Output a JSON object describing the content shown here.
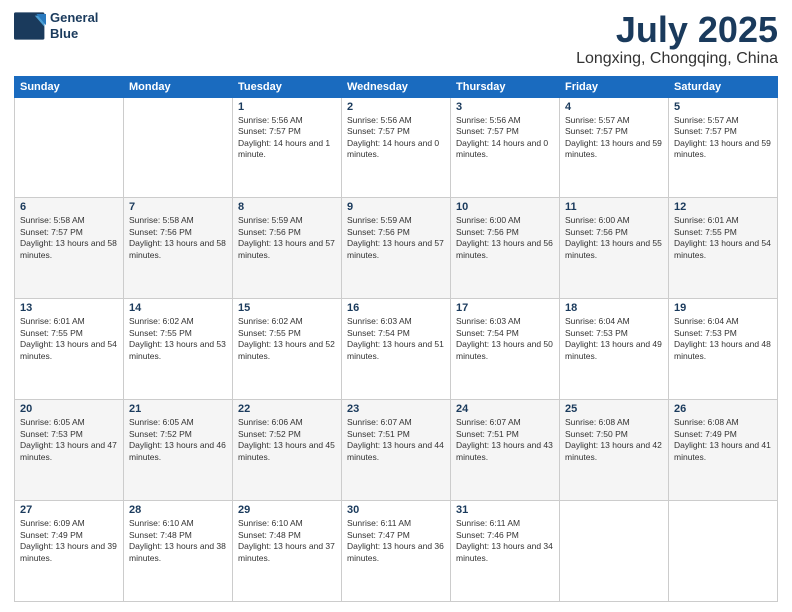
{
  "header": {
    "logo_line1": "General",
    "logo_line2": "Blue",
    "month": "July 2025",
    "location": "Longxing, Chongqing, China"
  },
  "weekdays": [
    "Sunday",
    "Monday",
    "Tuesday",
    "Wednesday",
    "Thursday",
    "Friday",
    "Saturday"
  ],
  "weeks": [
    [
      {
        "day": "",
        "sunrise": "",
        "sunset": "",
        "daylight": ""
      },
      {
        "day": "",
        "sunrise": "",
        "sunset": "",
        "daylight": ""
      },
      {
        "day": "1",
        "sunrise": "Sunrise: 5:56 AM",
        "sunset": "Sunset: 7:57 PM",
        "daylight": "Daylight: 14 hours and 1 minute."
      },
      {
        "day": "2",
        "sunrise": "Sunrise: 5:56 AM",
        "sunset": "Sunset: 7:57 PM",
        "daylight": "Daylight: 14 hours and 0 minutes."
      },
      {
        "day": "3",
        "sunrise": "Sunrise: 5:56 AM",
        "sunset": "Sunset: 7:57 PM",
        "daylight": "Daylight: 14 hours and 0 minutes."
      },
      {
        "day": "4",
        "sunrise": "Sunrise: 5:57 AM",
        "sunset": "Sunset: 7:57 PM",
        "daylight": "Daylight: 13 hours and 59 minutes."
      },
      {
        "day": "5",
        "sunrise": "Sunrise: 5:57 AM",
        "sunset": "Sunset: 7:57 PM",
        "daylight": "Daylight: 13 hours and 59 minutes."
      }
    ],
    [
      {
        "day": "6",
        "sunrise": "Sunrise: 5:58 AM",
        "sunset": "Sunset: 7:57 PM",
        "daylight": "Daylight: 13 hours and 58 minutes."
      },
      {
        "day": "7",
        "sunrise": "Sunrise: 5:58 AM",
        "sunset": "Sunset: 7:56 PM",
        "daylight": "Daylight: 13 hours and 58 minutes."
      },
      {
        "day": "8",
        "sunrise": "Sunrise: 5:59 AM",
        "sunset": "Sunset: 7:56 PM",
        "daylight": "Daylight: 13 hours and 57 minutes."
      },
      {
        "day": "9",
        "sunrise": "Sunrise: 5:59 AM",
        "sunset": "Sunset: 7:56 PM",
        "daylight": "Daylight: 13 hours and 57 minutes."
      },
      {
        "day": "10",
        "sunrise": "Sunrise: 6:00 AM",
        "sunset": "Sunset: 7:56 PM",
        "daylight": "Daylight: 13 hours and 56 minutes."
      },
      {
        "day": "11",
        "sunrise": "Sunrise: 6:00 AM",
        "sunset": "Sunset: 7:56 PM",
        "daylight": "Daylight: 13 hours and 55 minutes."
      },
      {
        "day": "12",
        "sunrise": "Sunrise: 6:01 AM",
        "sunset": "Sunset: 7:55 PM",
        "daylight": "Daylight: 13 hours and 54 minutes."
      }
    ],
    [
      {
        "day": "13",
        "sunrise": "Sunrise: 6:01 AM",
        "sunset": "Sunset: 7:55 PM",
        "daylight": "Daylight: 13 hours and 54 minutes."
      },
      {
        "day": "14",
        "sunrise": "Sunrise: 6:02 AM",
        "sunset": "Sunset: 7:55 PM",
        "daylight": "Daylight: 13 hours and 53 minutes."
      },
      {
        "day": "15",
        "sunrise": "Sunrise: 6:02 AM",
        "sunset": "Sunset: 7:55 PM",
        "daylight": "Daylight: 13 hours and 52 minutes."
      },
      {
        "day": "16",
        "sunrise": "Sunrise: 6:03 AM",
        "sunset": "Sunset: 7:54 PM",
        "daylight": "Daylight: 13 hours and 51 minutes."
      },
      {
        "day": "17",
        "sunrise": "Sunrise: 6:03 AM",
        "sunset": "Sunset: 7:54 PM",
        "daylight": "Daylight: 13 hours and 50 minutes."
      },
      {
        "day": "18",
        "sunrise": "Sunrise: 6:04 AM",
        "sunset": "Sunset: 7:53 PM",
        "daylight": "Daylight: 13 hours and 49 minutes."
      },
      {
        "day": "19",
        "sunrise": "Sunrise: 6:04 AM",
        "sunset": "Sunset: 7:53 PM",
        "daylight": "Daylight: 13 hours and 48 minutes."
      }
    ],
    [
      {
        "day": "20",
        "sunrise": "Sunrise: 6:05 AM",
        "sunset": "Sunset: 7:53 PM",
        "daylight": "Daylight: 13 hours and 47 minutes."
      },
      {
        "day": "21",
        "sunrise": "Sunrise: 6:05 AM",
        "sunset": "Sunset: 7:52 PM",
        "daylight": "Daylight: 13 hours and 46 minutes."
      },
      {
        "day": "22",
        "sunrise": "Sunrise: 6:06 AM",
        "sunset": "Sunset: 7:52 PM",
        "daylight": "Daylight: 13 hours and 45 minutes."
      },
      {
        "day": "23",
        "sunrise": "Sunrise: 6:07 AM",
        "sunset": "Sunset: 7:51 PM",
        "daylight": "Daylight: 13 hours and 44 minutes."
      },
      {
        "day": "24",
        "sunrise": "Sunrise: 6:07 AM",
        "sunset": "Sunset: 7:51 PM",
        "daylight": "Daylight: 13 hours and 43 minutes."
      },
      {
        "day": "25",
        "sunrise": "Sunrise: 6:08 AM",
        "sunset": "Sunset: 7:50 PM",
        "daylight": "Daylight: 13 hours and 42 minutes."
      },
      {
        "day": "26",
        "sunrise": "Sunrise: 6:08 AM",
        "sunset": "Sunset: 7:49 PM",
        "daylight": "Daylight: 13 hours and 41 minutes."
      }
    ],
    [
      {
        "day": "27",
        "sunrise": "Sunrise: 6:09 AM",
        "sunset": "Sunset: 7:49 PM",
        "daylight": "Daylight: 13 hours and 39 minutes."
      },
      {
        "day": "28",
        "sunrise": "Sunrise: 6:10 AM",
        "sunset": "Sunset: 7:48 PM",
        "daylight": "Daylight: 13 hours and 38 minutes."
      },
      {
        "day": "29",
        "sunrise": "Sunrise: 6:10 AM",
        "sunset": "Sunset: 7:48 PM",
        "daylight": "Daylight: 13 hours and 37 minutes."
      },
      {
        "day": "30",
        "sunrise": "Sunrise: 6:11 AM",
        "sunset": "Sunset: 7:47 PM",
        "daylight": "Daylight: 13 hours and 36 minutes."
      },
      {
        "day": "31",
        "sunrise": "Sunrise: 6:11 AM",
        "sunset": "Sunset: 7:46 PM",
        "daylight": "Daylight: 13 hours and 34 minutes."
      },
      {
        "day": "",
        "sunrise": "",
        "sunset": "",
        "daylight": ""
      },
      {
        "day": "",
        "sunrise": "",
        "sunset": "",
        "daylight": ""
      }
    ]
  ]
}
